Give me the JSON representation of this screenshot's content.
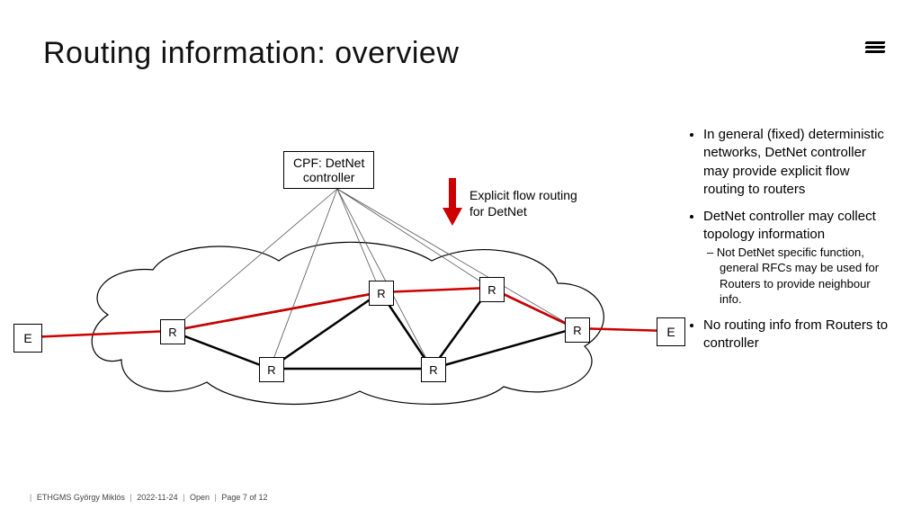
{
  "title": "Routing information: overview",
  "controller_l1": "CPF: DetNet",
  "controller_l2": "controller",
  "arrow_label_l1": "Explicit flow routing",
  "arrow_label_l2": "for DetNet",
  "labels": {
    "E": "E",
    "R": "R"
  },
  "bullets": {
    "b1": "In general (fixed) deterministic networks, DetNet controller may provide explicit flow routing to routers",
    "b2": "DetNet controller may collect topology information",
    "b2s1": "Not DetNet specific function, general RFCs may be used for Routers to provide neighbour info.",
    "b3": "No routing info from Routers to controller"
  },
  "footer": {
    "author": "ETHGMS György Miklós",
    "date": "2022-11-24",
    "class": "Open",
    "page": "Page 7 of 12"
  }
}
